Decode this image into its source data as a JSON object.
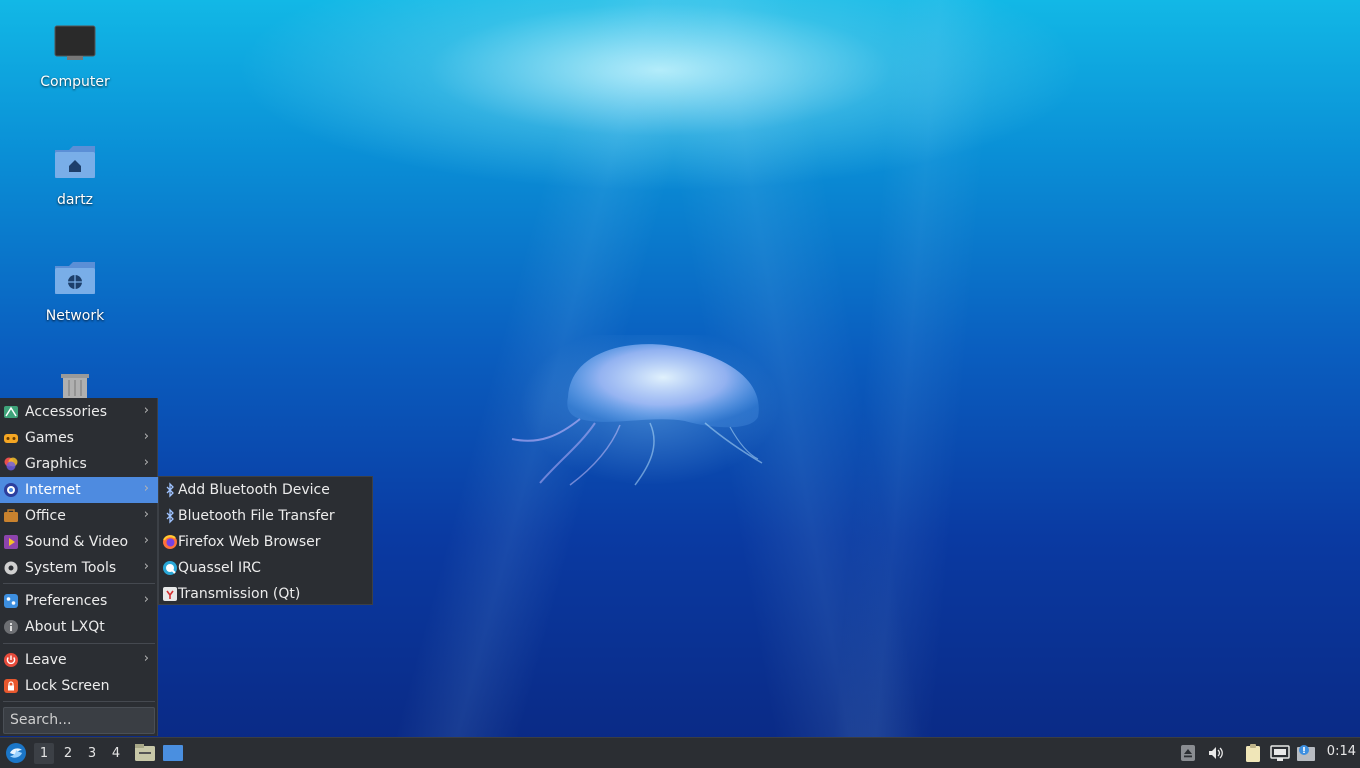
{
  "desktop": {
    "icons": [
      {
        "label": "Computer",
        "icon": "monitor-icon"
      },
      {
        "label": "dartz",
        "icon": "home-folder-icon"
      },
      {
        "label": "Network",
        "icon": "network-folder-icon"
      },
      {
        "label": "",
        "icon": "trash-icon"
      }
    ]
  },
  "menu": {
    "items": [
      {
        "label": "Accessories",
        "icon": "accessories-icon",
        "submenu": true
      },
      {
        "label": "Games",
        "icon": "games-icon",
        "submenu": true
      },
      {
        "label": "Graphics",
        "icon": "graphics-icon",
        "submenu": true
      },
      {
        "label": "Internet",
        "icon": "internet-icon",
        "submenu": true,
        "active": true
      },
      {
        "label": "Office",
        "icon": "office-icon",
        "submenu": true
      },
      {
        "label": "Sound & Video",
        "icon": "sound-video-icon",
        "submenu": true
      },
      {
        "label": "System Tools",
        "icon": "system-tools-icon",
        "submenu": true
      },
      {
        "label": "Preferences",
        "icon": "preferences-icon",
        "submenu": true
      },
      {
        "label": "About LXQt",
        "icon": "info-icon",
        "submenu": false
      },
      {
        "label": "Leave",
        "icon": "power-icon",
        "submenu": true
      },
      {
        "label": "Lock Screen",
        "icon": "lock-icon",
        "submenu": false
      }
    ],
    "arrow": "›",
    "search_placeholder": "Search..."
  },
  "submenu": {
    "items": [
      {
        "label": "Add Bluetooth Device",
        "icon": "bluetooth-icon"
      },
      {
        "label": "Bluetooth File Transfer",
        "icon": "bluetooth-icon"
      },
      {
        "label": "Firefox Web Browser",
        "icon": "firefox-icon"
      },
      {
        "label": "Quassel IRC",
        "icon": "quassel-icon"
      },
      {
        "label": "Transmission (Qt)",
        "icon": "transmission-icon"
      }
    ]
  },
  "taskbar": {
    "workspaces": [
      "1",
      "2",
      "3",
      "4"
    ],
    "active_workspace": "1",
    "clock": "0:14"
  },
  "colors": {
    "menu_bg": "#2b2e33",
    "highlight": "#4e8be0"
  }
}
